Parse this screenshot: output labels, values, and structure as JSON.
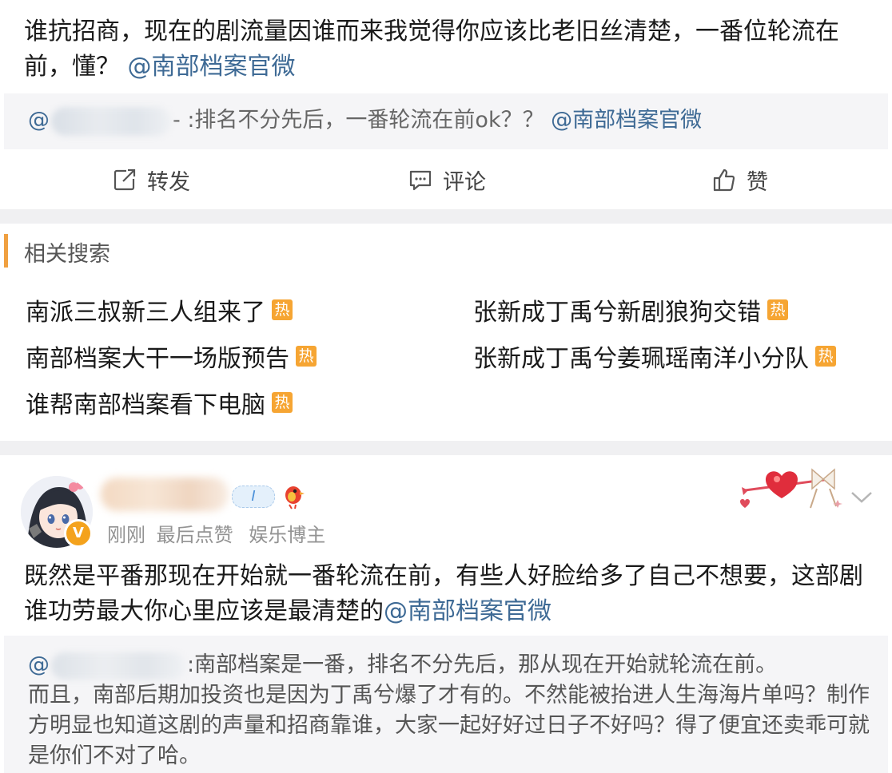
{
  "post1": {
    "text": "谁抗招商，现在的剧流量因谁而来我觉得你应该比老旧丝清楚，一番位轮流在前，懂？",
    "mention": "@南部档案官微",
    "quote": {
      "prefix": "@",
      "suffix": "- :排名不分先后，一番轮流在前ok？？",
      "mention": "@南部档案官微"
    }
  },
  "actions": {
    "repost": "转发",
    "comment": "评论",
    "like": "赞"
  },
  "related_search": {
    "title": "相关搜索",
    "hot_label": "热",
    "items": [
      "南派三叔新三人组来了",
      "张新成丁禹兮新剧狼狗交错",
      "南部档案大干一场版预告",
      "张新成丁禹兮姜珮瑶南洋小分队",
      "谁帮南部档案看下电脑"
    ]
  },
  "post2": {
    "level": "I",
    "badge": "V",
    "meta_time": "刚刚",
    "meta_like": "最后点赞",
    "meta_role": "娱乐博主",
    "text": "既然是平番那现在开始就一番轮流在前，有些人好脸给多了自己不想要，这部剧谁功劳最大你心里应该是最清楚的",
    "mention": "@南部档案官微",
    "quote": {
      "prefix": "@",
      "line1_suffix": ":南部档案是一番，排名不分先后，那从现在开始就轮流在前。",
      "rest": "而且，南部后期加投资也是因为丁禹兮爆了才有的。不然能被抬进人生海海片单吗？制作方明显也知道这剧的声量和招商靠谁，大家一起好好过日子不好吗？得了便宜还卖乖可就是你们不对了哈。"
    }
  },
  "colors": {
    "link": "#3e6a95",
    "hot": "#f6a533",
    "accent_bar": "#f0a040",
    "separator": "#f0f0f2",
    "quote_bg": "#f5f5f7"
  }
}
